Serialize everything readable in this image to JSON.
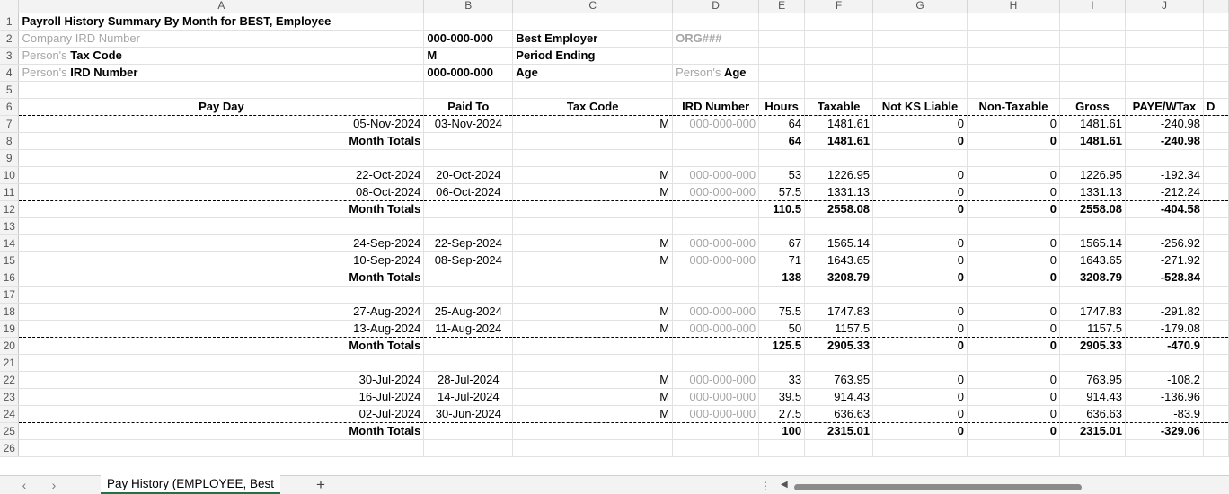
{
  "columns": [
    "A",
    "B",
    "C",
    "D",
    "E",
    "F",
    "G",
    "H",
    "I",
    "J"
  ],
  "sheet": {
    "title": "Payroll History Summary By Month for BEST, Employee",
    "company_ird_label": "Company IRD Number",
    "company_ird_value": "000-000-000",
    "employer_name": "Best Employer",
    "org_code": "ORG###",
    "person_prefix": "Person's",
    "tax_code_label": "Tax Code",
    "tax_code_value": "M",
    "period_ending_label": "Period Ending",
    "ird_number_label": "IRD Number",
    "person_ird_value": "000-000-000",
    "age_label": "Age",
    "age_label2": "Age"
  },
  "headers": [
    "Pay Day",
    "Paid To",
    "Tax Code",
    "IRD Number",
    "Hours",
    "Taxable",
    "Not KS Liable",
    "Non-Taxable",
    "Gross",
    "PAYE/WTax",
    "D"
  ],
  "rows": [
    {
      "n": "7",
      "type": "data",
      "pay_day": "05-Nov-2024",
      "paid_to": "03-Nov-2024",
      "tax": "M",
      "ird": "000-000-000",
      "hours": "64",
      "taxable": "1481.61",
      "nks": "0",
      "nt": "0",
      "gross": "1481.61",
      "paye": "-240.98",
      "dash": false
    },
    {
      "n": "8",
      "type": "total",
      "pay_day": "Month Totals",
      "paid_to": "",
      "tax": "",
      "ird": "",
      "hours": "64",
      "taxable": "1481.61",
      "nks": "0",
      "nt": "0",
      "gross": "1481.61",
      "paye": "-240.98",
      "dash": false
    },
    {
      "n": "9",
      "type": "blank"
    },
    {
      "n": "10",
      "type": "data",
      "pay_day": "22-Oct-2024",
      "paid_to": "20-Oct-2024",
      "tax": "M",
      "ird": "000-000-000",
      "hours": "53",
      "taxable": "1226.95",
      "nks": "0",
      "nt": "0",
      "gross": "1226.95",
      "paye": "-192.34",
      "dash": false
    },
    {
      "n": "11",
      "type": "data",
      "pay_day": "08-Oct-2024",
      "paid_to": "06-Oct-2024",
      "tax": "M",
      "ird": "000-000-000",
      "hours": "57.5",
      "taxable": "1331.13",
      "nks": "0",
      "nt": "0",
      "gross": "1331.13",
      "paye": "-212.24",
      "dash": true
    },
    {
      "n": "12",
      "type": "total",
      "pay_day": "Month Totals",
      "paid_to": "",
      "tax": "",
      "ird": "",
      "hours": "110.5",
      "taxable": "2558.08",
      "nks": "0",
      "nt": "0",
      "gross": "2558.08",
      "paye": "-404.58",
      "dash": false
    },
    {
      "n": "13",
      "type": "blank"
    },
    {
      "n": "14",
      "type": "data",
      "pay_day": "24-Sep-2024",
      "paid_to": "22-Sep-2024",
      "tax": "M",
      "ird": "000-000-000",
      "hours": "67",
      "taxable": "1565.14",
      "nks": "0",
      "nt": "0",
      "gross": "1565.14",
      "paye": "-256.92",
      "dash": false
    },
    {
      "n": "15",
      "type": "data",
      "pay_day": "10-Sep-2024",
      "paid_to": "08-Sep-2024",
      "tax": "M",
      "ird": "000-000-000",
      "hours": "71",
      "taxable": "1643.65",
      "nks": "0",
      "nt": "0",
      "gross": "1643.65",
      "paye": "-271.92",
      "dash": true
    },
    {
      "n": "16",
      "type": "total",
      "pay_day": "Month Totals",
      "paid_to": "",
      "tax": "",
      "ird": "",
      "hours": "138",
      "taxable": "3208.79",
      "nks": "0",
      "nt": "0",
      "gross": "3208.79",
      "paye": "-528.84",
      "dash": false
    },
    {
      "n": "17",
      "type": "blank"
    },
    {
      "n": "18",
      "type": "data",
      "pay_day": "27-Aug-2024",
      "paid_to": "25-Aug-2024",
      "tax": "M",
      "ird": "000-000-000",
      "hours": "75.5",
      "taxable": "1747.83",
      "nks": "0",
      "nt": "0",
      "gross": "1747.83",
      "paye": "-291.82",
      "dash": false
    },
    {
      "n": "19",
      "type": "data",
      "pay_day": "13-Aug-2024",
      "paid_to": "11-Aug-2024",
      "tax": "M",
      "ird": "000-000-000",
      "hours": "50",
      "taxable": "1157.5",
      "nks": "0",
      "nt": "0",
      "gross": "1157.5",
      "paye": "-179.08",
      "dash": true
    },
    {
      "n": "20",
      "type": "total",
      "pay_day": "Month Totals",
      "paid_to": "",
      "tax": "",
      "ird": "",
      "hours": "125.5",
      "taxable": "2905.33",
      "nks": "0",
      "nt": "0",
      "gross": "2905.33",
      "paye": "-470.9",
      "dash": false
    },
    {
      "n": "21",
      "type": "blank"
    },
    {
      "n": "22",
      "type": "data",
      "pay_day": "30-Jul-2024",
      "paid_to": "28-Jul-2024",
      "tax": "M",
      "ird": "000-000-000",
      "hours": "33",
      "taxable": "763.95",
      "nks": "0",
      "nt": "0",
      "gross": "763.95",
      "paye": "-108.2",
      "dash": false
    },
    {
      "n": "23",
      "type": "data",
      "pay_day": "16-Jul-2024",
      "paid_to": "14-Jul-2024",
      "tax": "M",
      "ird": "000-000-000",
      "hours": "39.5",
      "taxable": "914.43",
      "nks": "0",
      "nt": "0",
      "gross": "914.43",
      "paye": "-136.96",
      "dash": false
    },
    {
      "n": "24",
      "type": "data",
      "pay_day": "02-Jul-2024",
      "paid_to": "30-Jun-2024",
      "tax": "M",
      "ird": "000-000-000",
      "hours": "27.5",
      "taxable": "636.63",
      "nks": "0",
      "nt": "0",
      "gross": "636.63",
      "paye": "-83.9",
      "dash": true
    },
    {
      "n": "25",
      "type": "total",
      "pay_day": "Month Totals",
      "paid_to": "",
      "tax": "",
      "ird": "",
      "hours": "100",
      "taxable": "2315.01",
      "nks": "0",
      "nt": "0",
      "gross": "2315.01",
      "paye": "-329.06",
      "dash": false
    },
    {
      "n": "26",
      "type": "blank"
    }
  ],
  "tabbar": {
    "prev": "‹",
    "next": "›",
    "active_tab": "Pay History (EMPLOYEE, Best",
    "add": "+",
    "more": "⋮",
    "scroll_left": "◀"
  }
}
